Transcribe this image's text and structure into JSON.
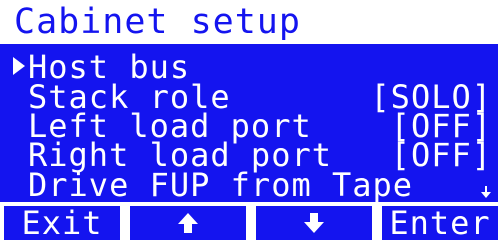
{
  "screen": {
    "title": "Cabinet setup",
    "colors": {
      "background": "#1414ef",
      "foreground": "#ffffff"
    }
  },
  "menu": {
    "items": [
      {
        "label": "Host bus",
        "value": "",
        "selected": true
      },
      {
        "label": "Stack role",
        "value": "[SOLO]"
      },
      {
        "label": "Left load port",
        "value": "[OFF]"
      },
      {
        "label": "Right load port",
        "value": "[OFF]"
      },
      {
        "label": "Drive FUP from Tape",
        "value": ""
      }
    ],
    "selector_icon": "selection-triangle-icon",
    "more_indicator_icon": "scroll-down-arrow-icon"
  },
  "softkeys": {
    "exit": "Exit",
    "up_icon": "up-arrow-icon",
    "down_icon": "down-arrow-icon",
    "enter": "Enter"
  }
}
